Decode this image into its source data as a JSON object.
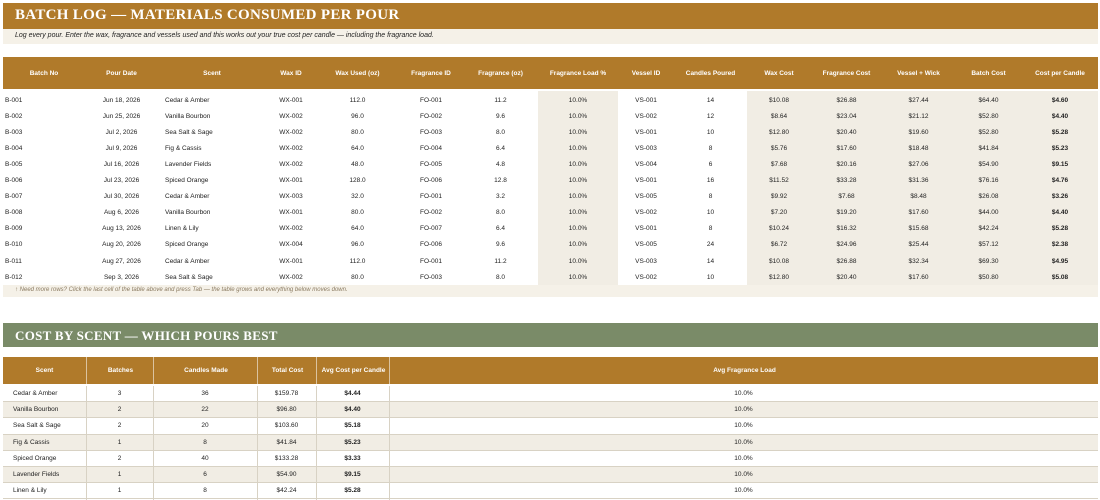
{
  "batch_log": {
    "title": "BATCH LOG — MATERIALS CONSUMED PER POUR",
    "note": "Log every pour. Enter the wax, fragrance and vessels used and this works out your true cost per candle — including the fragrance load.",
    "columns": [
      "Batch No",
      "Pour Date",
      "Scent",
      "Wax ID",
      "Wax Used (oz)",
      "Fragrance ID",
      "Fragrance (oz)",
      "Fragrance Load %",
      "Vessel ID",
      "Candles Poured",
      "Wax Cost",
      "Fragrance Cost",
      "Vessel + Wick",
      "Batch Cost",
      "Cost per Candle"
    ],
    "rows": [
      [
        "B-001",
        "Jun 18, 2026",
        "Cedar & Amber",
        "WX-001",
        "112.0",
        "FO-001",
        "11.2",
        "10.0%",
        "VS-001",
        "14",
        "$10.08",
        "$26.88",
        "$27.44",
        "$64.40",
        "$4.60"
      ],
      [
        "B-002",
        "Jun 25, 2026",
        "Vanilla Bourbon",
        "WX-002",
        "96.0",
        "FO-002",
        "9.6",
        "10.0%",
        "VS-002",
        "12",
        "$8.64",
        "$23.04",
        "$21.12",
        "$52.80",
        "$4.40"
      ],
      [
        "B-003",
        "Jul 2, 2026",
        "Sea Salt & Sage",
        "WX-002",
        "80.0",
        "FO-003",
        "8.0",
        "10.0%",
        "VS-001",
        "10",
        "$12.80",
        "$20.40",
        "$19.60",
        "$52.80",
        "$5.28"
      ],
      [
        "B-004",
        "Jul 9, 2026",
        "Fig & Cassis",
        "WX-002",
        "64.0",
        "FO-004",
        "6.4",
        "10.0%",
        "VS-003",
        "8",
        "$5.76",
        "$17.60",
        "$18.48",
        "$41.84",
        "$5.23"
      ],
      [
        "B-005",
        "Jul 16, 2026",
        "Lavender Fields",
        "WX-002",
        "48.0",
        "FO-005",
        "4.8",
        "10.0%",
        "VS-004",
        "6",
        "$7.68",
        "$20.16",
        "$27.06",
        "$54.90",
        "$9.15"
      ],
      [
        "B-006",
        "Jul 23, 2026",
        "Spiced Orange",
        "WX-001",
        "128.0",
        "FO-006",
        "12.8",
        "10.0%",
        "VS-001",
        "16",
        "$11.52",
        "$33.28",
        "$31.36",
        "$76.16",
        "$4.76"
      ],
      [
        "B-007",
        "Jul 30, 2026",
        "Cedar & Amber",
        "WX-003",
        "32.0",
        "FO-001",
        "3.2",
        "10.0%",
        "VS-005",
        "8",
        "$9.92",
        "$7.68",
        "$8.48",
        "$26.08",
        "$3.26"
      ],
      [
        "B-008",
        "Aug 6, 2026",
        "Vanilla Bourbon",
        "WX-001",
        "80.0",
        "FO-002",
        "8.0",
        "10.0%",
        "VS-002",
        "10",
        "$7.20",
        "$19.20",
        "$17.60",
        "$44.00",
        "$4.40"
      ],
      [
        "B-009",
        "Aug 13, 2026",
        "Linen & Lily",
        "WX-002",
        "64.0",
        "FO-007",
        "6.4",
        "10.0%",
        "VS-001",
        "8",
        "$10.24",
        "$16.32",
        "$15.68",
        "$42.24",
        "$5.28"
      ],
      [
        "B-010",
        "Aug 20, 2026",
        "Spiced Orange",
        "WX-004",
        "96.0",
        "FO-006",
        "9.6",
        "10.0%",
        "VS-005",
        "24",
        "$6.72",
        "$24.96",
        "$25.44",
        "$57.12",
        "$2.38"
      ],
      [
        "B-011",
        "Aug 27, 2026",
        "Cedar & Amber",
        "WX-001",
        "112.0",
        "FO-001",
        "11.2",
        "10.0%",
        "VS-003",
        "14",
        "$10.08",
        "$26.88",
        "$32.34",
        "$69.30",
        "$4.95"
      ],
      [
        "B-012",
        "Sep 3, 2026",
        "Sea Salt & Sage",
        "WX-002",
        "80.0",
        "FO-003",
        "8.0",
        "10.0%",
        "VS-002",
        "10",
        "$12.80",
        "$20.40",
        "$17.60",
        "$50.80",
        "$5.08"
      ]
    ],
    "hint": "↑ Need more rows? Click the last cell of the table above and press Tab — the table grows and everything below moves down."
  },
  "cost_by_scent": {
    "title": "COST BY SCENT — WHICH POURS BEST",
    "columns": [
      "Scent",
      "Batches",
      "Candles Made",
      "Total Cost",
      "Avg Cost per Candle",
      "Avg Fragrance Load"
    ],
    "rows": [
      [
        "Cedar & Amber",
        "3",
        "36",
        "$159.78",
        "$4.44",
        "10.0%"
      ],
      [
        "Vanilla Bourbon",
        "2",
        "22",
        "$96.80",
        "$4.40",
        "10.0%"
      ],
      [
        "Sea Salt & Sage",
        "2",
        "20",
        "$103.60",
        "$5.18",
        "10.0%"
      ],
      [
        "Fig & Cassis",
        "1",
        "8",
        "$41.84",
        "$5.23",
        "10.0%"
      ],
      [
        "Spiced Orange",
        "2",
        "40",
        "$133.28",
        "$3.33",
        "10.0%"
      ],
      [
        "Lavender Fields",
        "1",
        "6",
        "$54.90",
        "$9.15",
        "10.0%"
      ],
      [
        "Linen & Lily",
        "1",
        "8",
        "$42.24",
        "$5.28",
        "10.0%"
      ]
    ]
  },
  "colors": {
    "accent": "#b07a2a",
    "section_green": "#7a8b68",
    "band": "#f1ede4"
  }
}
